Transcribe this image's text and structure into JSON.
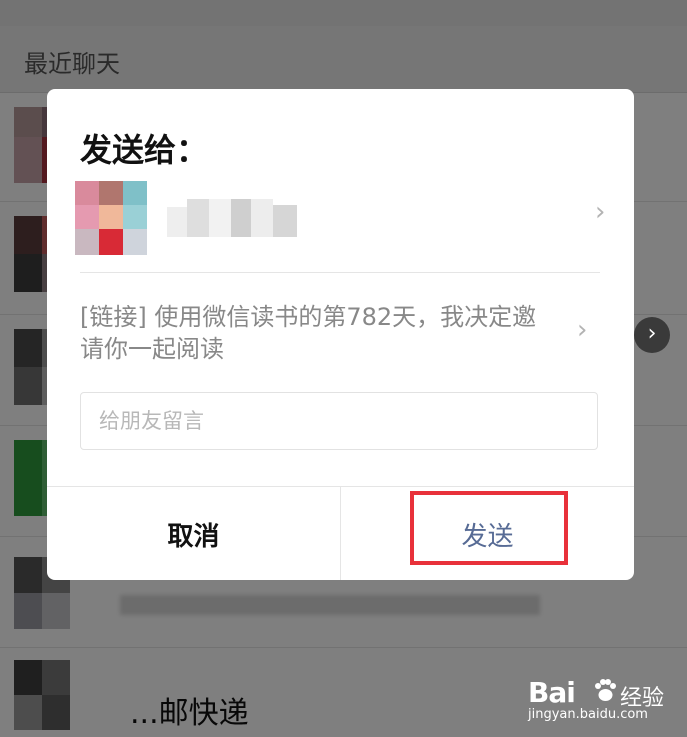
{
  "section_header": "最近聊天",
  "chat_rows": [
    {
      "name": ""
    },
    {
      "name": ""
    },
    {
      "name": ""
    },
    {
      "name": ""
    },
    {
      "name": "..."
    },
    {
      "name": "...邮快递"
    }
  ],
  "dialog": {
    "title": "发送给：",
    "recipient_name": "",
    "link_text": "[链接] 使用微信读书的第782天，我决定邀请你一起阅读",
    "message_placeholder": "给朋友留言",
    "message_value": "",
    "cancel_label": "取消",
    "send_label": "发送"
  },
  "icons": {
    "chevron": "chevron-right-icon",
    "side_arrow": "chevron-right-circle-icon"
  },
  "colors": {
    "send": "#576b95",
    "highlight": "#e8313a",
    "overlay": "rgba(0,0,0,0.5)"
  },
  "watermark": {
    "brand": "Bai",
    "brand_suffix": "经验",
    "url": "jingyan.baidu.com"
  }
}
